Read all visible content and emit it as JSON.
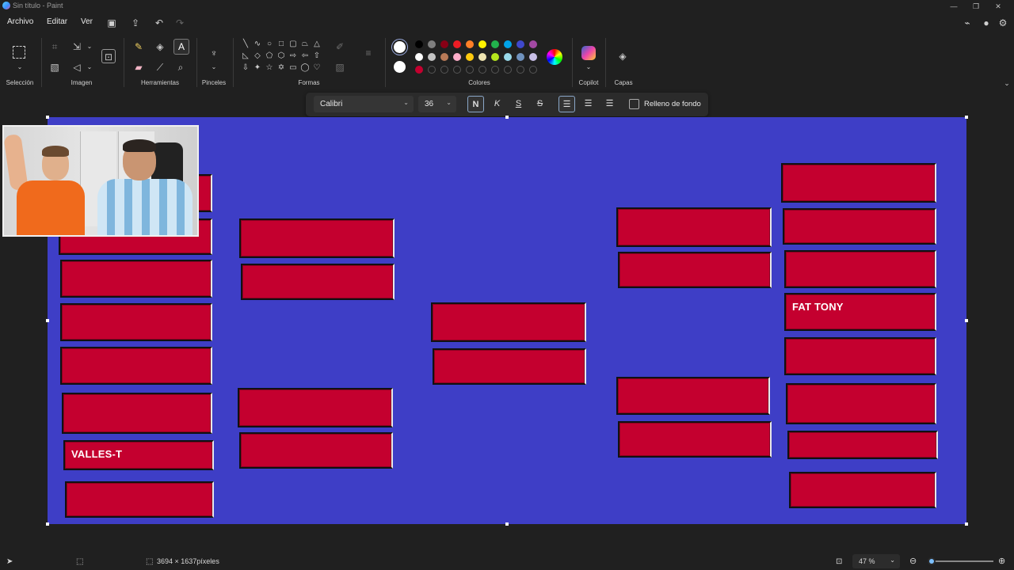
{
  "window": {
    "title": "Sin título - Paint",
    "controls": {
      "minimize": "—",
      "restore": "❐",
      "close": "✕"
    }
  },
  "menu": {
    "file": "Archivo",
    "edit": "Editar",
    "view": "Ver"
  },
  "ribbon": {
    "groups": {
      "selection": "Selección",
      "image": "Imagen",
      "tools": "Herramientas",
      "brushes": "Pinceles",
      "shapes": "Formas",
      "colors": "Colores",
      "copilot": "Copilot",
      "layers": "Capas"
    },
    "active_tool": "text-tool",
    "palette_row1": [
      "#000000",
      "#7f7f7f",
      "#880015",
      "#ed1c24",
      "#ff7f27",
      "#fff200",
      "#22b14c",
      "#00a2e8",
      "#3f48cc",
      "#a349a4"
    ],
    "palette_row2": [
      "#ffffff",
      "#c3c3c3",
      "#b97a57",
      "#ffaec9",
      "#ffc90e",
      "#efe4b0",
      "#b5e61d",
      "#99d9ea",
      "#7092be",
      "#c8bfe7"
    ],
    "palette_row3": [
      "#c4002f"
    ],
    "primary_color": "#ffffff",
    "secondary_color": "#ffffff"
  },
  "text_toolbar": {
    "font": "Calibri",
    "size": "36",
    "bold": "N",
    "italic": "K",
    "underline": "S",
    "strikethrough": "S",
    "fill_background_label": "Relleno de fondo",
    "fill_background_checked": false
  },
  "canvas": {
    "background": "#3e3ec6",
    "box_color": "#c4002f",
    "labels": {
      "valles": "VALLES-T",
      "fat_tony": "FAT TONY"
    }
  },
  "status": {
    "dimensions": "3694 × 1637píxeles",
    "zoom": "47 %",
    "zoom_fraction": 0.05
  }
}
